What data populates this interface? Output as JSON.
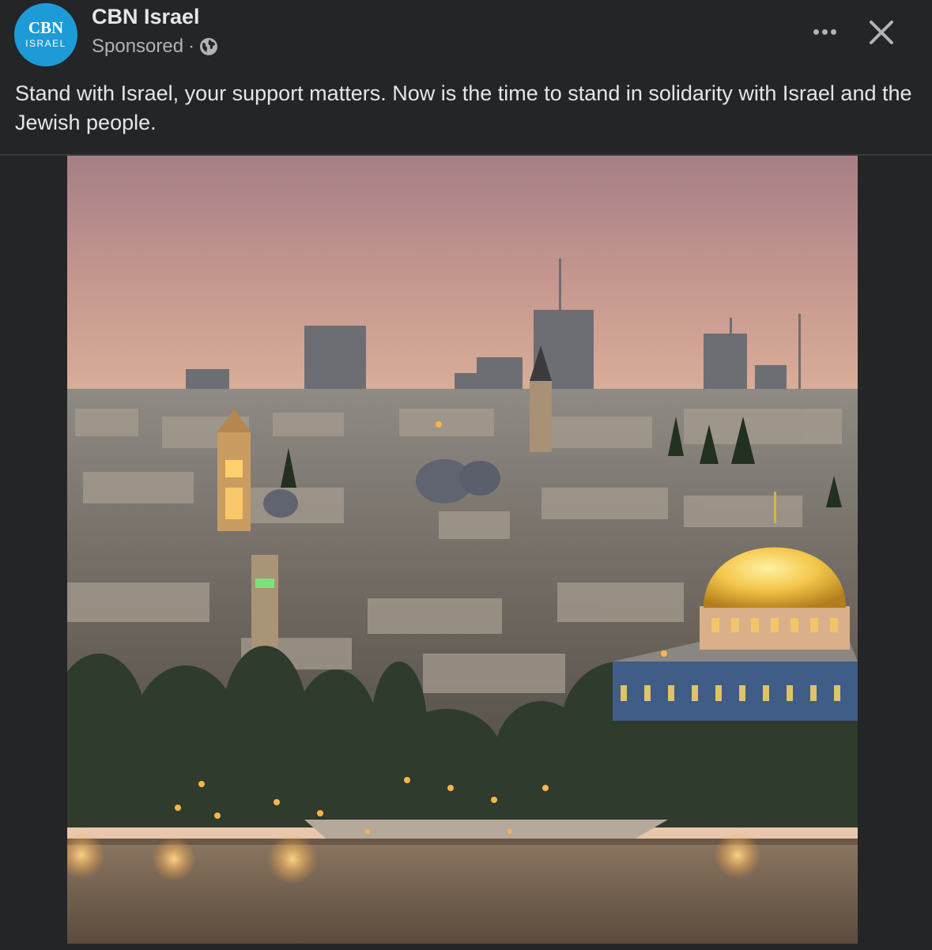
{
  "post": {
    "page_name": "CBN Israel",
    "avatar": {
      "logo_main": "CBN",
      "logo_sub": "ISRAEL",
      "color": "#1d9bd7"
    },
    "sponsored_label": "Sponsored",
    "separator": "·",
    "audience_icon": "globe-icon",
    "more_icon": "more-horizontal-icon",
    "close_icon": "close-icon",
    "caption": "Stand with Israel, your support matters. Now is the time to stand in solidarity with Israel and the Jewish people.",
    "image": {
      "subject": "Jerusalem Old City skyline at dusk with golden dome",
      "colors": {
        "sky_top": "#b98a86",
        "sky_bottom": "#e6c2a6",
        "gold": "#f3c64a"
      }
    }
  }
}
